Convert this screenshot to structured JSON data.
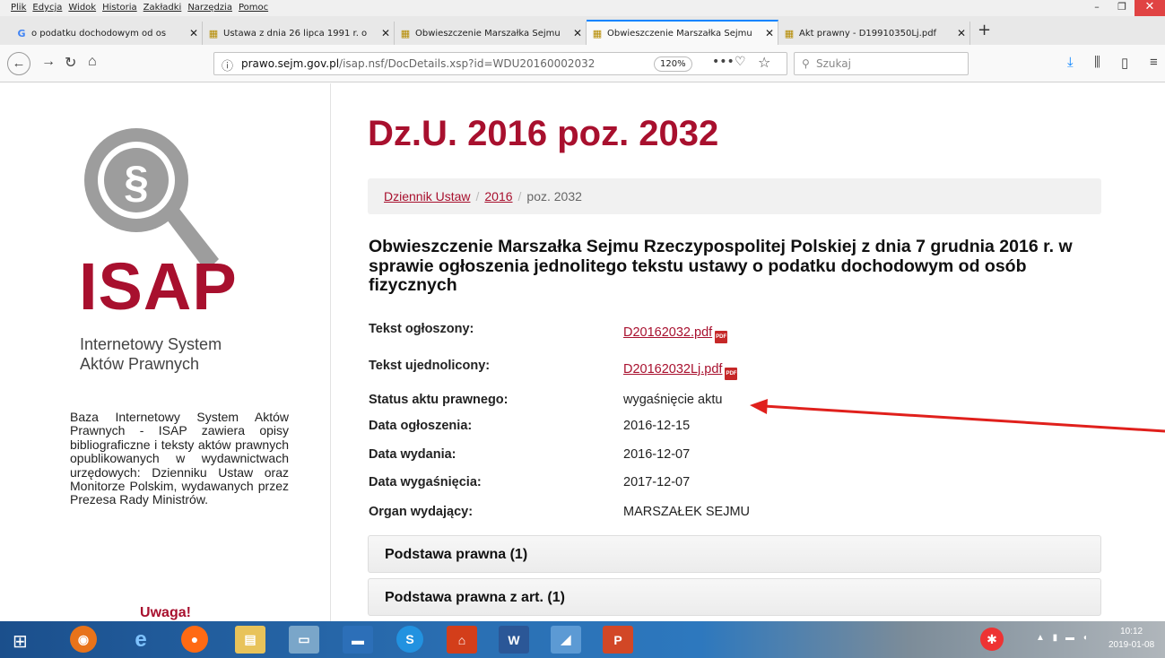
{
  "menubar": {
    "items": [
      "Plik",
      "Edycja",
      "Widok",
      "Historia",
      "Zakładki",
      "Narzędzia",
      "Pomoc"
    ]
  },
  "tabs": [
    {
      "title": "o podatku dochodowym od os",
      "icon": "google-icon"
    },
    {
      "title": "Ustawa z dnia 26 lipca 1991 r. o",
      "icon": "sejm-icon"
    },
    {
      "title": "Obwieszczenie Marszałka Sejmu",
      "icon": "sejm-icon"
    },
    {
      "title": "Obwieszczenie Marszałka Sejmu",
      "icon": "sejm-icon",
      "active": true
    },
    {
      "title": "Akt prawny - D19910350Lj.pdf",
      "icon": "sejm-icon"
    }
  ],
  "navbar": {
    "url_host": "prawo.sejm.gov.pl",
    "url_path": "/isap.nsf/DocDetails.xsp?id=WDU20160002032",
    "zoom": "120%",
    "search_placeholder": "Szukaj"
  },
  "sidebar": {
    "logo_word": "ISAP",
    "logo_sub1": "Internetowy System",
    "logo_sub2": "Aktów Prawnych",
    "about": "Baza Internetowy System Aktów Prawnych - ISAP zawiera opisy bibliograficzne i teksty aktów prawnych opublikowanych w wydawnictwach urzędowych: Dzienniku Ustaw oraz Monitorze Polskim, wydawanych przez Prezesa Rady Ministrów.",
    "warning": "Uwaga!"
  },
  "main": {
    "title": "Dz.U. 2016 poz. 2032",
    "breadcrumb": {
      "item1": "Dziennik Ustaw",
      "item2": "2016",
      "current": "poz. 2032",
      "separator": "/"
    },
    "act_title": "Obwieszczenie Marszałka Sejmu Rzeczypospolitej Polskiej z dnia 7 grudnia 2016 r. w sprawie ogłoszenia jednolitego tekstu ustawy o podatku dochodowym od osób fizycznych",
    "meta": [
      {
        "key": "Tekst ogłoszony:",
        "value": "D20162032.pdf",
        "link": true
      },
      {
        "key": "Tekst ujednolicony:",
        "value": "D20162032Lj.pdf",
        "link": true
      },
      {
        "key": "Status aktu prawnego:",
        "value": "wygaśnięcie aktu"
      },
      {
        "key": "Data ogłoszenia:",
        "value": "2016-12-15"
      },
      {
        "key": "Data wydania:",
        "value": "2016-12-07"
      },
      {
        "key": "Data wygaśnięcia:",
        "value": "2017-12-07"
      },
      {
        "key": "Organ wydający:",
        "value": "MARSZAŁEK SEJMU"
      }
    ],
    "pdf_icon_label": "PDF",
    "panels": [
      "Podstawa prawna (1)",
      "Podstawa prawna z art. (1)"
    ]
  },
  "taskbar": {
    "clock_time": "10:12",
    "clock_date": "2019-01-08"
  },
  "colors": {
    "brand": "#a8102e",
    "accent": "#0a84ff",
    "annotation_arrow": "#e0201c"
  }
}
